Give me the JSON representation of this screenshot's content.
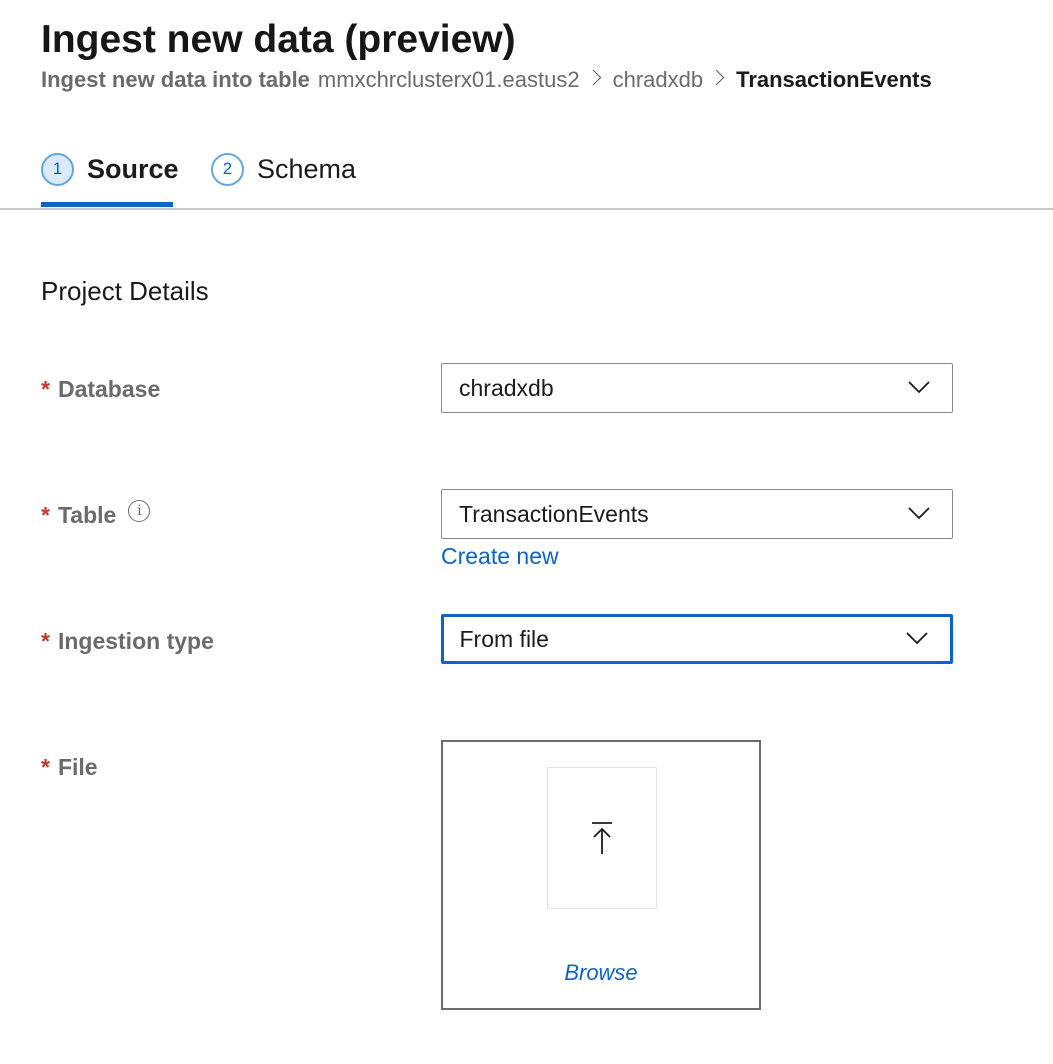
{
  "header": {
    "title": "Ingest new data (preview)",
    "breadcrumb": {
      "lead": "Ingest new data into table",
      "items": [
        "mmxchrclusterx01.eastus2",
        "chradxdb",
        "TransactionEvents"
      ]
    }
  },
  "tabs": [
    {
      "step": "1",
      "label": "Source",
      "active": true
    },
    {
      "step": "2",
      "label": "Schema",
      "active": false
    }
  ],
  "section_title": "Project Details",
  "required_marker": "*",
  "fields": {
    "database": {
      "label": "Database",
      "value": "chradxdb"
    },
    "table": {
      "label": "Table",
      "value": "TransactionEvents",
      "info_glyph": "i",
      "create_new": "Create new"
    },
    "ingestion_type": {
      "label": "Ingestion type",
      "value": "From file"
    },
    "file": {
      "label": "File",
      "browse": "Browse"
    }
  },
  "icons": {
    "dropdown": "chevron-down-icon",
    "upload": "upload-icon",
    "info": "info-icon",
    "breadcrumb_separator": "chevron-right-icon"
  },
  "colors": {
    "accent": "#0e63c8",
    "required": "#c0392b",
    "label": "#6b6b6b"
  }
}
